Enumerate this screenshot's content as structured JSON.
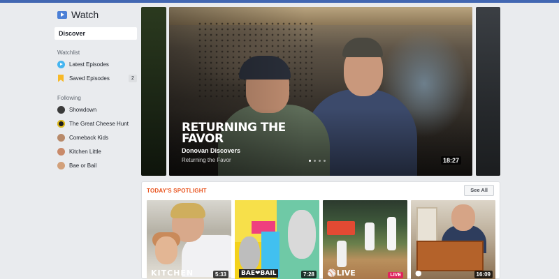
{
  "app": {
    "title": "Watch",
    "icon": "watch-icon"
  },
  "sidebar": {
    "discover": "Discover",
    "watchlist_title": "Watchlist",
    "watchlist": [
      {
        "label": "Latest Episodes",
        "icon": "play-icon"
      },
      {
        "label": "Saved Episodes",
        "icon": "bookmark-icon",
        "badge": "2"
      }
    ],
    "following_title": "Following",
    "following": [
      {
        "label": "Showdown",
        "avatar_color": "#3a3a3a"
      },
      {
        "label": "The Great Cheese Hunt",
        "avatar_color": "#1c1c1c"
      },
      {
        "label": "Comeback Kids",
        "avatar_color": "#b88a6a"
      },
      {
        "label": "Kitchen Little",
        "avatar_color": "#c98a6a"
      },
      {
        "label": "Bae or Bail",
        "avatar_color": "#d2a07a"
      }
    ]
  },
  "hero": {
    "show_logo": "RETURNING THE FAVOR",
    "title": "Donovan Discovers",
    "subtitle": "Returning the Favor",
    "duration": "18:27",
    "slide_count": 4,
    "active_slide": 1
  },
  "spotlight": {
    "title": "TODAY'S SPOTLIGHT",
    "see_all": "See All",
    "items": [
      {
        "logo": "KITCHEN",
        "duration": "5:33"
      },
      {
        "logo": "BAE❤BAIL",
        "duration": "7:28"
      },
      {
        "logo": "⚾LIVE",
        "live": "LIVE"
      },
      {
        "logo": "●",
        "duration": "16:09"
      }
    ]
  },
  "colors": {
    "accent": "#4267b2",
    "spotlight_title": "#e9541f",
    "live": "#e0245e"
  }
}
